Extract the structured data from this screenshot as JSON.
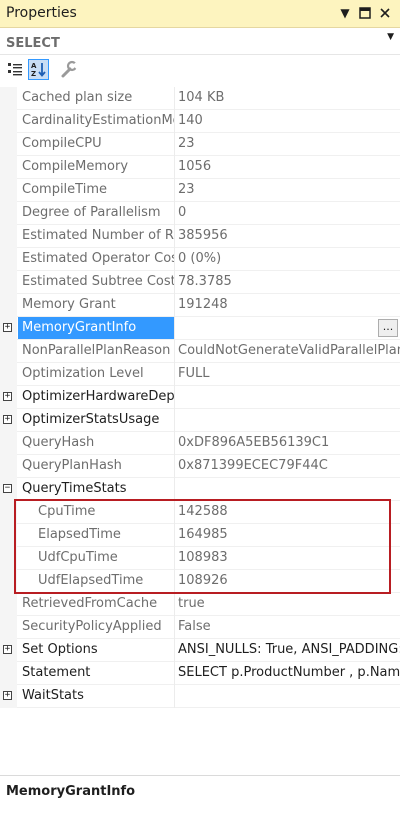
{
  "window": {
    "title": "Properties"
  },
  "object": {
    "name": "SELECT"
  },
  "icons": {
    "dropdown": "chevron-down-icon",
    "maximize": "maximize-icon",
    "close": "close-icon",
    "categorized": "categorized-icon",
    "alphabetical": "alphabetical-sort-icon",
    "property_pages": "wrench-icon"
  },
  "properties": [
    {
      "name": "Cached plan size",
      "value": "104 KB"
    },
    {
      "name": "CardinalityEstimationModelVersion",
      "value": "140"
    },
    {
      "name": "CompileCPU",
      "value": "23"
    },
    {
      "name": "CompileMemory",
      "value": "1056"
    },
    {
      "name": "CompileTime",
      "value": "23"
    },
    {
      "name": "Degree of Parallelism",
      "value": "0"
    },
    {
      "name": "Estimated Number of Rows",
      "value": "385956"
    },
    {
      "name": "Estimated Operator Cost",
      "value": "0 (0%)"
    },
    {
      "name": "Estimated Subtree Cost",
      "value": "78.3785"
    },
    {
      "name": "Memory Grant",
      "value": "191248"
    },
    {
      "name": "MemoryGrantInfo",
      "value": "",
      "expandable": true,
      "selected": true,
      "button": "..."
    },
    {
      "name": "NonParallelPlanReason",
      "value": "CouldNotGenerateValidParallelPlan"
    },
    {
      "name": "Optimization Level",
      "value": "FULL"
    },
    {
      "name": "OptimizerHardwareDependentProperties",
      "value": "",
      "expandable": true
    },
    {
      "name": "OptimizerStatsUsage",
      "value": "",
      "expandable": true
    },
    {
      "name": "QueryHash",
      "value": "0xDF896A5EB56139C1"
    },
    {
      "name": "QueryPlanHash",
      "value": "0x871399ECEC79F44C"
    },
    {
      "name": "QueryTimeStats",
      "value": "",
      "expandable": true,
      "expanded": true
    },
    {
      "name": "CpuTime",
      "value": "142588",
      "child": true
    },
    {
      "name": "ElapsedTime",
      "value": "164985",
      "child": true
    },
    {
      "name": "UdfCpuTime",
      "value": "108983",
      "child": true
    },
    {
      "name": "UdfElapsedTime",
      "value": "108926",
      "child": true
    },
    {
      "name": "RetrievedFromCache",
      "value": "true"
    },
    {
      "name": "SecurityPolicyApplied",
      "value": "False"
    },
    {
      "name": "Set Options",
      "value": "ANSI_NULLS: True, ANSI_PADDING: True",
      "expandable": true,
      "dark": true
    },
    {
      "name": "Statement",
      "value": "SELECT     p.ProductNumber , p.Name",
      "dark": true
    },
    {
      "name": "WaitStats",
      "value": "",
      "expandable": true
    }
  ],
  "description": {
    "title": "MemoryGrantInfo"
  },
  "colors": {
    "highlight_border": "#b81d22",
    "selection": "#3399ff",
    "titlebar": "#fdf4bf"
  }
}
